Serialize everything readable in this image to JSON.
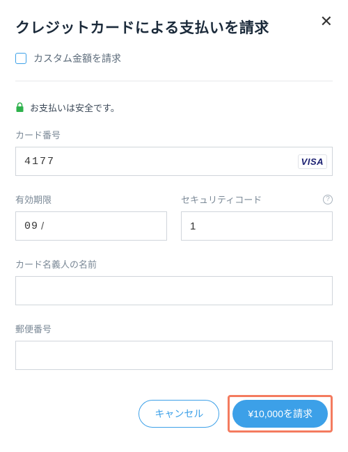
{
  "dialog": {
    "title": "クレジットカードによる支払いを請求",
    "custom_amount_label": "カスタム金額を請求",
    "secure_text": "お支払いは安全です。"
  },
  "fields": {
    "card_number": {
      "label": "カード番号",
      "value": "4177",
      "brand": "VISA"
    },
    "expiry": {
      "label": "有効期限",
      "month": "09",
      "separator": "/"
    },
    "security_code": {
      "label": "セキュリティコード",
      "value": "1"
    },
    "cardholder": {
      "label": "カード名義人の名前",
      "value": ""
    },
    "postal": {
      "label": "郵便番号",
      "value": ""
    }
  },
  "buttons": {
    "cancel": "キャンセル",
    "submit": "¥10,000を請求"
  },
  "colors": {
    "accent": "#3ca0e8",
    "highlight": "#f47b5f",
    "lock": "#2eb24c"
  }
}
